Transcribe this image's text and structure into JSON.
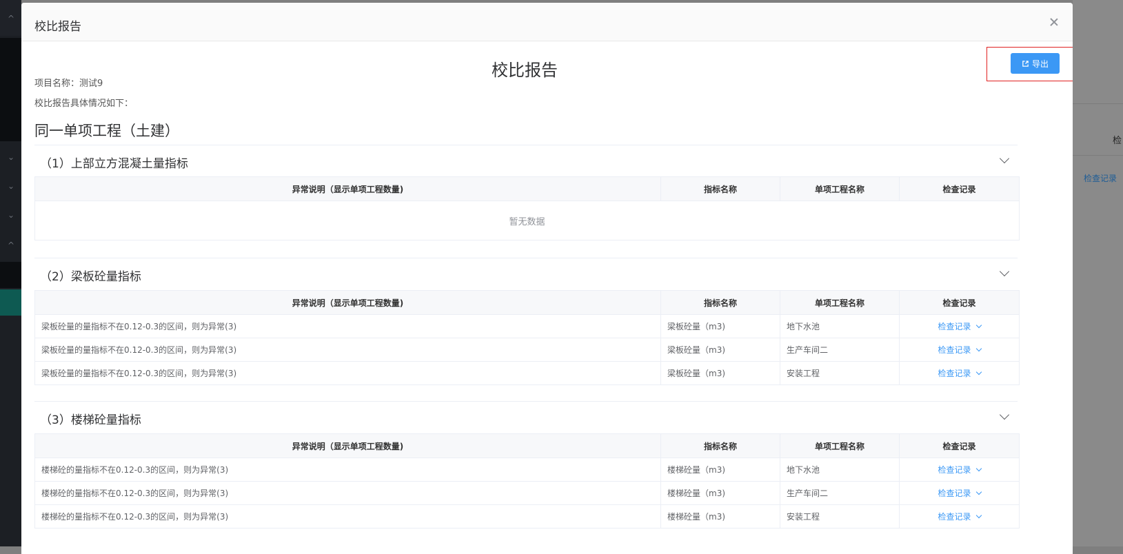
{
  "modal": {
    "title": "校比报告",
    "report_title": "校比报告",
    "export_label": "导出",
    "project_label": "项目名称：测试9",
    "intro": "校比报告具体情况如下：",
    "section_heading": "同一单项工程（土建）"
  },
  "table_headers": [
    "异常说明（显示单项工程数量)",
    "指标名称",
    "单项工程名称",
    "检查记录"
  ],
  "sections": [
    {
      "title": "（1）上部立方混凝土量指标",
      "empty_text": "暂无数据"
    },
    {
      "title": "（2）梁板砼量指标"
    },
    {
      "title": "（3）楼梯砼量指标"
    }
  ],
  "rows": {
    "section2": [
      {
        "desc": "梁板砼量的量指标不在0.12-0.3的区间，则为异常(3)",
        "metric": "梁板砼量（m3)",
        "project": "地下水池",
        "record": "检查记录"
      },
      {
        "desc": "梁板砼量的量指标不在0.12-0.3的区间，则为异常(3)",
        "metric": "梁板砼量（m3)",
        "project": "生产车间二",
        "record": "检查记录"
      },
      {
        "desc": "梁板砼量的量指标不在0.12-0.3的区间，则为异常(3)",
        "metric": "梁板砼量（m3)",
        "project": "安装工程",
        "record": "检查记录"
      }
    ],
    "section3": [
      {
        "desc": "楼梯砼的量指标不在0.12-0.3的区间，则为异常(3)",
        "metric": "楼梯砼量（m3)",
        "project": "地下水池",
        "record": "检查记录"
      },
      {
        "desc": "楼梯砼的量指标不在0.12-0.3的区间，则为异常(3)",
        "metric": "楼梯砼量（m3)",
        "project": "生产车间二",
        "record": "检查记录"
      },
      {
        "desc": "楼梯砼的量指标不在0.12-0.3的区间，则为异常(3)",
        "metric": "楼梯砼量（m3)",
        "project": "安装工程",
        "record": "检查记录"
      }
    ]
  },
  "background": {
    "column_label_partial": "检",
    "record_link_partial": "检查记录"
  },
  "colors": {
    "primary": "#3b98f5",
    "highlight_border": "#e02020",
    "sidebar": "#1c1f24"
  }
}
